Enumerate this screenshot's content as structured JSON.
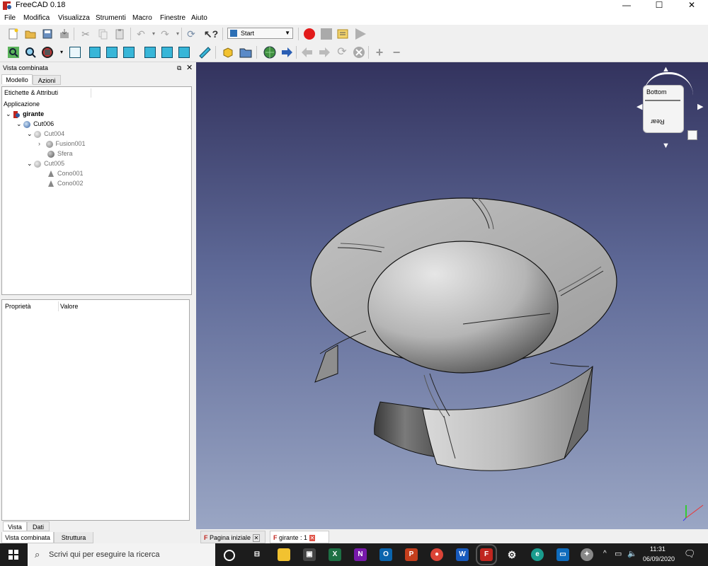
{
  "window": {
    "title": "FreeCAD 0.18"
  },
  "menu": [
    "File",
    "Modifica",
    "Visualizza",
    "Strumenti",
    "Macro",
    "Finestre",
    "Aiuto"
  ],
  "toolbar": {
    "workbench": "Start"
  },
  "left_panel": {
    "header": "Vista combinata",
    "tabs": [
      "Modello",
      "Azioni"
    ],
    "column_header": "Etichette & Attributi",
    "tree_root": "Applicazione",
    "tree": [
      {
        "label": "girante",
        "icon": "document-icon"
      },
      {
        "label": "Cut006",
        "icon": "cut-icon"
      },
      {
        "label": "Cut004",
        "icon": "cut-icon"
      },
      {
        "label": "Fusion001",
        "icon": "fusion-icon"
      },
      {
        "label": "Sfera",
        "icon": "sphere-icon"
      },
      {
        "label": "Cut005",
        "icon": "cut-icon"
      },
      {
        "label": "Cono001",
        "icon": "cone-icon"
      },
      {
        "label": "Cono002",
        "icon": "cone-icon"
      }
    ],
    "property_headers": [
      "Proprietà",
      "Valore"
    ],
    "view_tabs": [
      "Vista",
      "Dati"
    ],
    "bottom_tabs": [
      "Vista combinata",
      "Struttura"
    ]
  },
  "navcube": {
    "face_top": "Bottom",
    "face_bottom": "Rear"
  },
  "doc_tabs": [
    "Pagina iniziale",
    "girante : 1"
  ],
  "taskbar": {
    "search_placeholder": "Scrivi qui per eseguire la ricerca",
    "time": "11:31",
    "date": "06/09/2020"
  },
  "colors": {
    "viewport_top": "#33335e",
    "viewport_bottom": "#9aa6c4",
    "accent": "#38b6d8"
  }
}
